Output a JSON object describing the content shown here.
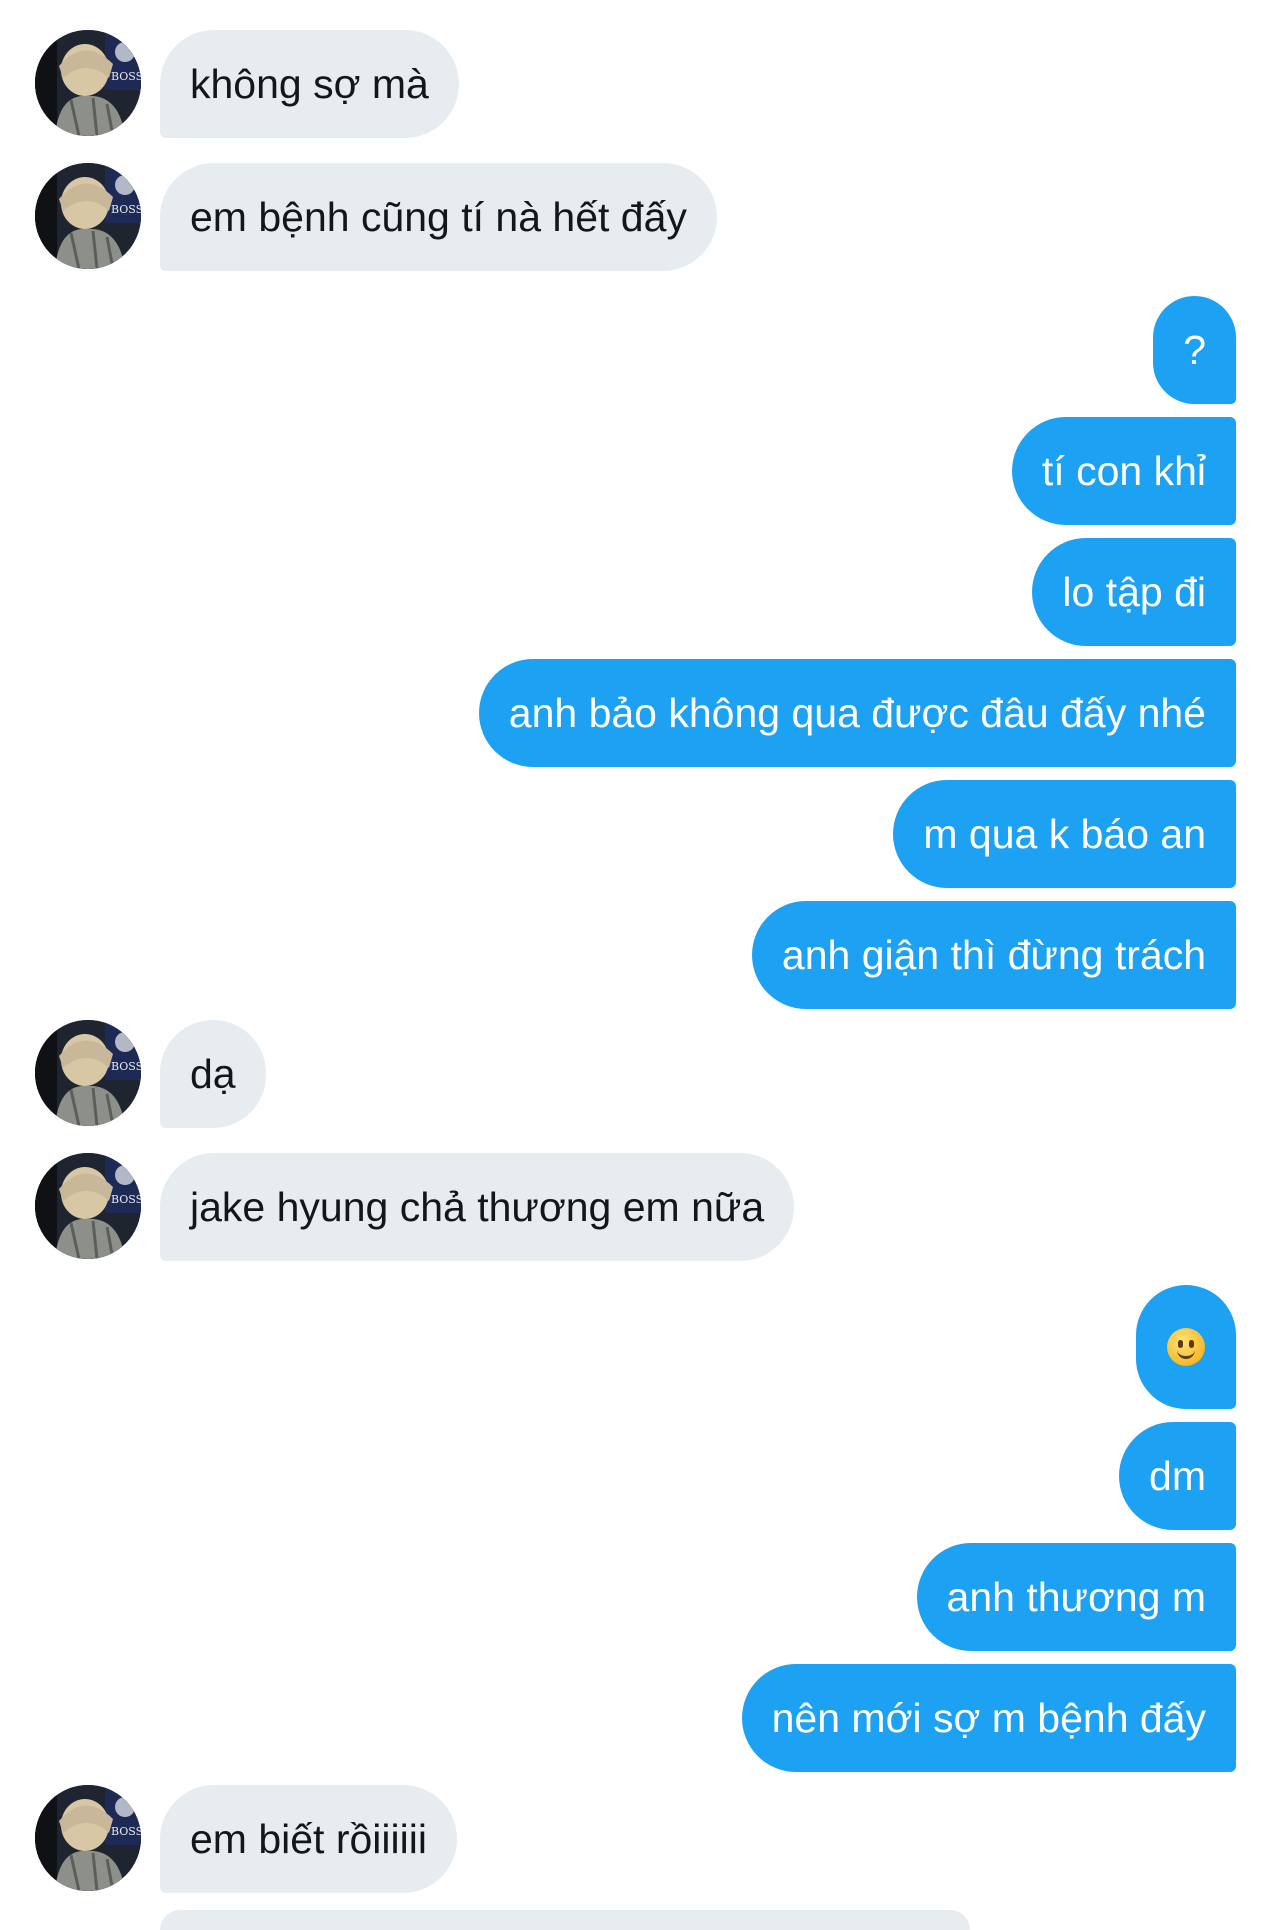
{
  "conversation": {
    "messages": [
      {
        "side": "incoming",
        "text": "không sợ mà"
      },
      {
        "side": "incoming",
        "text": "em bệnh cũng tí nà hết đấy"
      },
      {
        "side": "outgoing",
        "text": "?"
      },
      {
        "side": "outgoing",
        "text": "tí con khỉ"
      },
      {
        "side": "outgoing",
        "text": "lo tập đi"
      },
      {
        "side": "outgoing",
        "text": "anh bảo không qua được đâu đấy nhé"
      },
      {
        "side": "outgoing",
        "text": "m qua k báo an"
      },
      {
        "side": "outgoing",
        "text": "anh giận thì đừng trách"
      },
      {
        "side": "incoming",
        "text": "dạ"
      },
      {
        "side": "incoming",
        "text": "jake hyung chả thương em nữa"
      },
      {
        "side": "outgoing",
        "emoji": "slightly-smiling-face"
      },
      {
        "side": "outgoing",
        "text": "dm"
      },
      {
        "side": "outgoing",
        "text": "anh thương m"
      },
      {
        "side": "outgoing",
        "text": "nên mới sợ m bệnh đấy"
      },
      {
        "side": "incoming",
        "text": "em biết rồiiiiii"
      }
    ]
  },
  "colors": {
    "incoming_bubble": "#e6ecf0",
    "incoming_text": "#14171a",
    "outgoing_bubble": "#1da1f2",
    "outgoing_text": "#ffffff"
  }
}
